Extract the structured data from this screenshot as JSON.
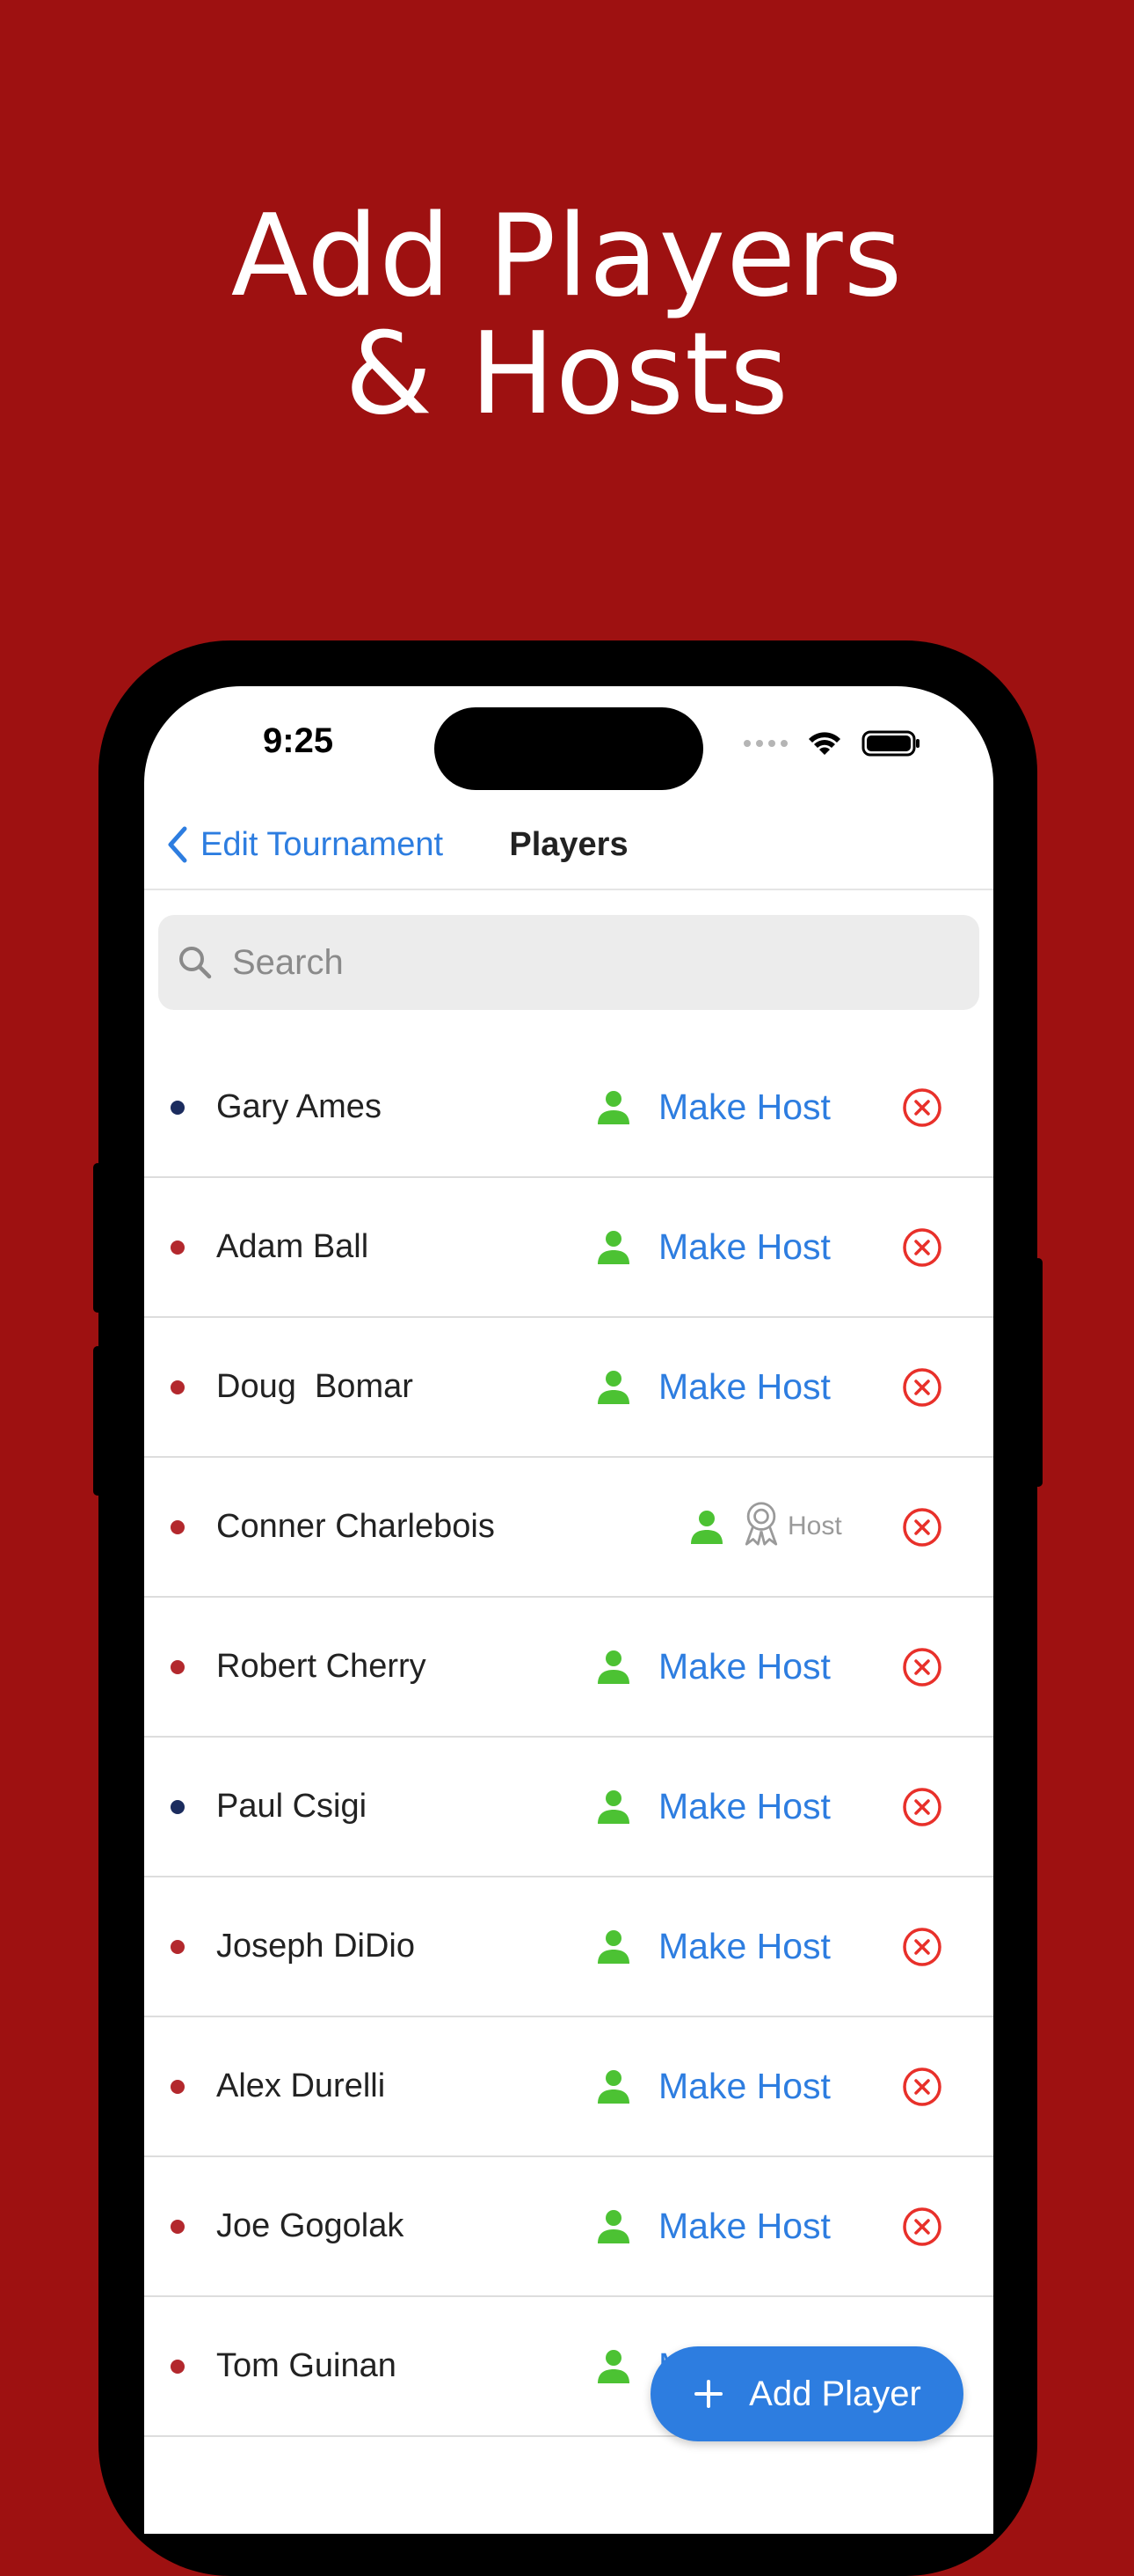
{
  "headline": {
    "line1": "Add Players",
    "line2": "& Hosts"
  },
  "status_bar": {
    "time": "9:25"
  },
  "nav": {
    "back_label": "Edit Tournament",
    "title": "Players"
  },
  "search": {
    "placeholder": "Search"
  },
  "colors": {
    "background": "#9e1111",
    "accent": "#2d7de0",
    "person_icon": "#4cc233",
    "remove_icon": "#e8302a",
    "dot_red": "#b3282d",
    "dot_navy": "#1b2c5e"
  },
  "players": [
    {
      "name": "Gary Ames",
      "dot": "navy",
      "action": "Make Host"
    },
    {
      "name": "Adam Ball",
      "dot": "red",
      "action": "Make Host"
    },
    {
      "name": "Doug  Bomar",
      "dot": "red",
      "action": "Make Host"
    },
    {
      "name": "Conner Charlebois",
      "dot": "red",
      "host_label": "Host"
    },
    {
      "name": "Robert Cherry",
      "dot": "red",
      "action": "Make Host"
    },
    {
      "name": "Paul Csigi",
      "dot": "navy",
      "action": "Make Host"
    },
    {
      "name": "Joseph DiDio",
      "dot": "red",
      "action": "Make Host"
    },
    {
      "name": "Alex Durelli",
      "dot": "red",
      "action": "Make Host"
    },
    {
      "name": "Joe Gogolak",
      "dot": "red",
      "action": "Make Host"
    },
    {
      "name": "Tom Guinan",
      "dot": "red",
      "action": "Make Host"
    }
  ],
  "fab": {
    "label": "Add Player"
  }
}
